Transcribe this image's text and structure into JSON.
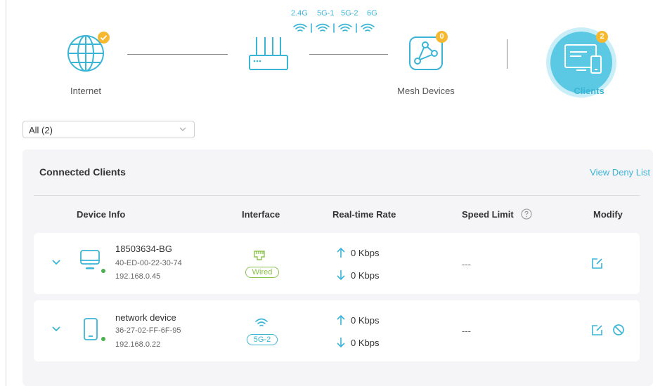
{
  "topology": {
    "internet_label": "Internet",
    "mesh_label": "Mesh Devices",
    "clients_label": "Clients",
    "mesh_badge": "0",
    "clients_badge": "2",
    "bands": [
      "2.4G",
      "5G-1",
      "5G-2",
      "6G"
    ]
  },
  "filter": {
    "selected": "All (2)"
  },
  "panel": {
    "title": "Connected Clients",
    "deny_link": "View Deny List",
    "headers": {
      "device_info": "Device Info",
      "interface": "Interface",
      "rate": "Real-time Rate",
      "speed_limit": "Speed Limit",
      "modify": "Modify"
    }
  },
  "clients": [
    {
      "name": "18503634-BG",
      "mac": "40-ED-00-22-30-74",
      "ip": "192.168.0.45",
      "interface": "Wired",
      "up": "0 Kbps",
      "down": "0 Kbps",
      "limit": "---"
    },
    {
      "name": "network device",
      "mac": "36-27-02-FF-6F-95",
      "ip": "192.168.0.22",
      "interface": "5G-2",
      "up": "0 Kbps",
      "down": "0 Kbps",
      "limit": "---"
    }
  ],
  "colors": {
    "accent": "#3ab5d6",
    "badge": "#f5b82e",
    "wired": "#8bc34a",
    "online": "#4caf50"
  }
}
